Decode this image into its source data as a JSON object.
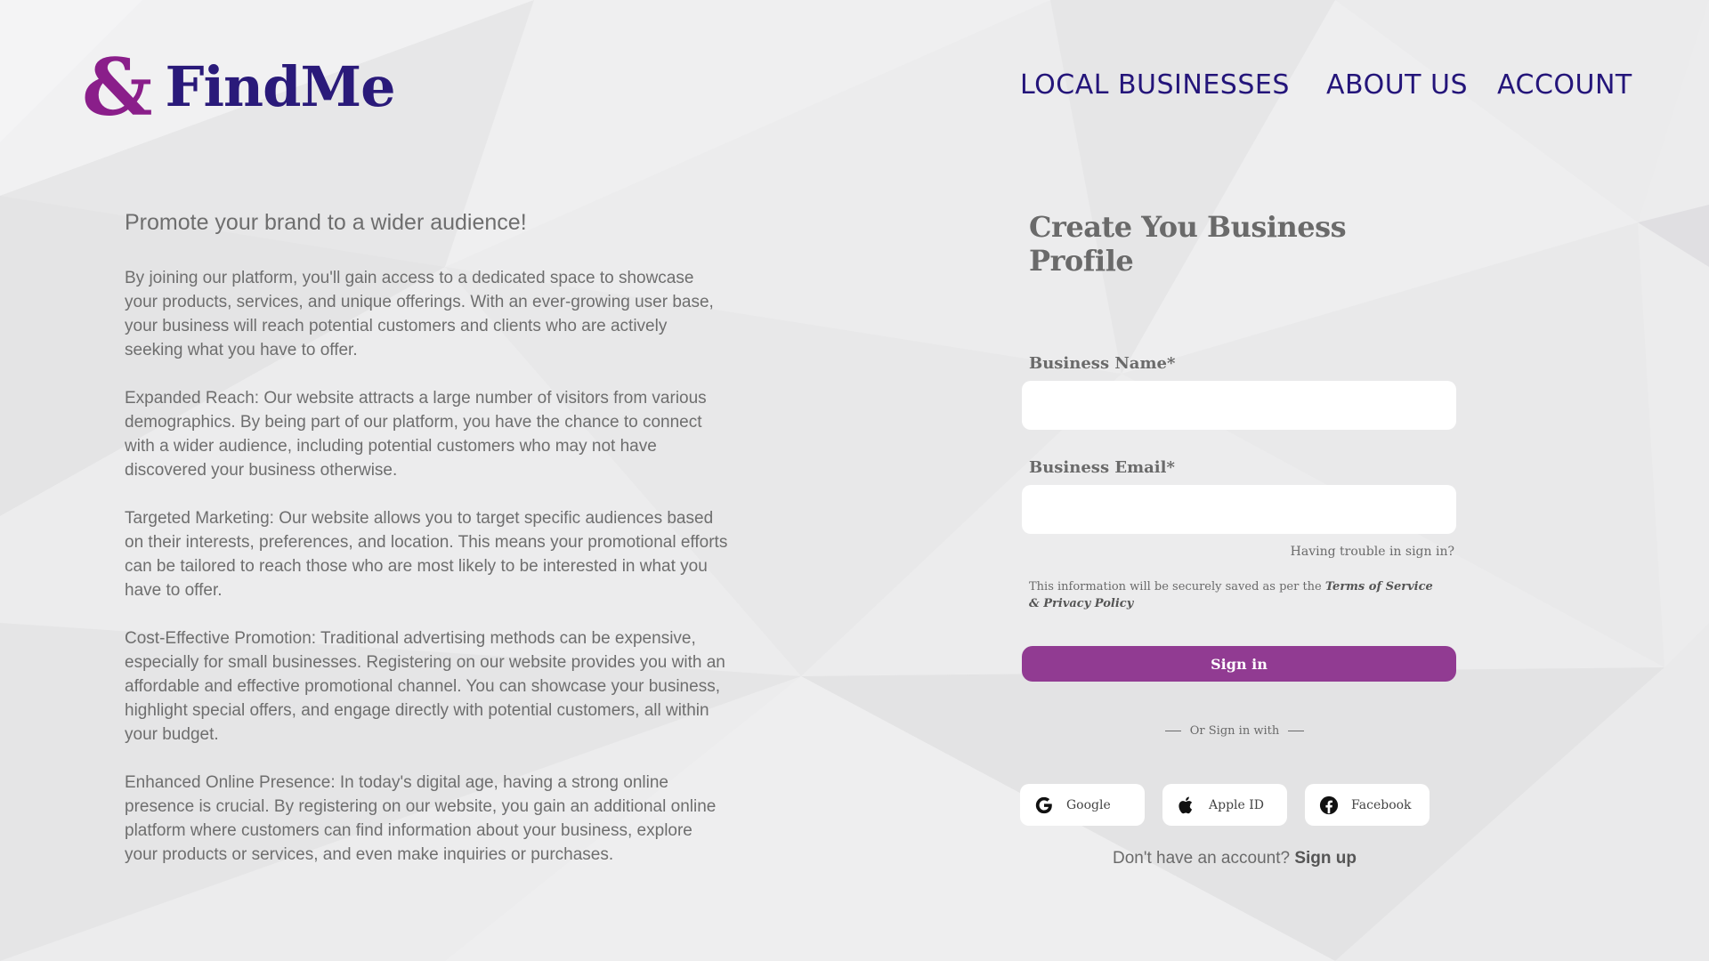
{
  "brand": {
    "ampersand": "&",
    "name": "FindMe",
    "amp_color": "#8a1e8a",
    "name_color": "#2a1a7a"
  },
  "nav": {
    "items": [
      {
        "label": "LOCAL BUSINESSES"
      },
      {
        "label": "ABOUT US"
      },
      {
        "label": "ACCOUNT"
      }
    ]
  },
  "intro": {
    "tagline": "Promote your brand to a wider audience!",
    "paragraphs": [
      "By joining our platform, you'll gain access to a dedicated space to showcase your products, services, and unique offerings. With an ever-growing user base, your business will reach potential customers and clients who are actively seeking what you have to offer.",
      "Expanded Reach: Our website attracts a large number of visitors from various demographics. By being part of our platform, you have the chance to connect with a wider audience, including potential customers who may not have discovered your business otherwise.",
      "Targeted Marketing: Our website allows you to target specific audiences based on their interests, preferences, and location. This means your promotional efforts can be tailored to reach those who are most likely to be interested in what you have to offer.",
      "Cost-Effective Promotion: Traditional advertising methods can be expensive, especially for small businesses. Registering on our website provides you with an affordable and effective promotional channel. You can showcase your business, highlight special offers, and engage directly with potential customers, all within your budget.",
      "Enhanced Online Presence: In today's digital age, having a strong online presence is crucial. By registering on our website, you gain an additional online platform where customers can find information about your business, explore your products or services, and even make inquiries or purchases."
    ]
  },
  "form": {
    "title": "Create You Business Profile",
    "business_name_label": "Business Name*",
    "business_name_value": "",
    "business_email_label": "Business Email*",
    "business_email_value": "",
    "trouble_link": "Having trouble in sign in?",
    "policy_prefix": "This information will be securely saved as per the ",
    "policy_link": "Terms of Service & Privacy Policy",
    "submit_label": "Sign in",
    "submit_color": "#913b92",
    "or_text": "Or Sign in with",
    "social": [
      {
        "label": "Google",
        "icon": "google-icon"
      },
      {
        "label": "Apple ID",
        "icon": "apple-icon"
      },
      {
        "label": "Facebook",
        "icon": "facebook-icon"
      }
    ],
    "signup_prompt": "Don't have an account?",
    "signup_link": "Sign up"
  }
}
